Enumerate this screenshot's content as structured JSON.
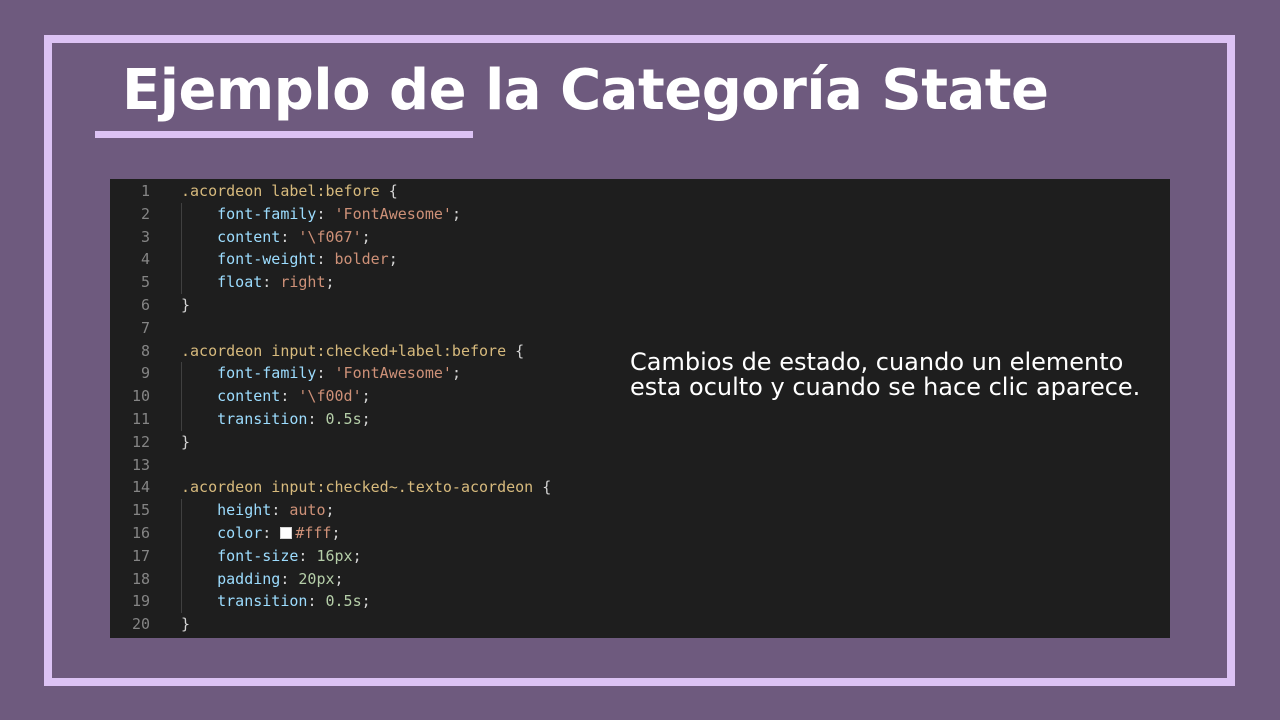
{
  "slide": {
    "title": "Ejemplo de la Categoría State",
    "note": "Cambios de estado, cuando un elemento esta oculto y cuando se hace clic aparece."
  },
  "code": {
    "lines": [
      {
        "n": "1",
        "tokens": [
          {
            "t": ".acordeon label:before",
            "c": "sel"
          },
          {
            "t": " {",
            "c": "punc"
          }
        ]
      },
      {
        "n": "2",
        "tokens": [
          {
            "t": "    ",
            "c": "punc"
          },
          {
            "t": "font-family",
            "c": "prop"
          },
          {
            "t": ": ",
            "c": "punc"
          },
          {
            "t": "'FontAwesome'",
            "c": "str"
          },
          {
            "t": ";",
            "c": "punc"
          }
        ]
      },
      {
        "n": "3",
        "tokens": [
          {
            "t": "    ",
            "c": "punc"
          },
          {
            "t": "content",
            "c": "prop"
          },
          {
            "t": ": ",
            "c": "punc"
          },
          {
            "t": "'\\f067'",
            "c": "str"
          },
          {
            "t": ";",
            "c": "punc"
          }
        ]
      },
      {
        "n": "4",
        "tokens": [
          {
            "t": "    ",
            "c": "punc"
          },
          {
            "t": "font-weight",
            "c": "prop"
          },
          {
            "t": ": ",
            "c": "punc"
          },
          {
            "t": "bolder",
            "c": "str"
          },
          {
            "t": ";",
            "c": "punc"
          }
        ]
      },
      {
        "n": "5",
        "tokens": [
          {
            "t": "    ",
            "c": "punc"
          },
          {
            "t": "float",
            "c": "prop"
          },
          {
            "t": ": ",
            "c": "punc"
          },
          {
            "t": "right",
            "c": "str"
          },
          {
            "t": ";",
            "c": "punc"
          }
        ]
      },
      {
        "n": "6",
        "tokens": [
          {
            "t": "}",
            "c": "punc"
          }
        ]
      },
      {
        "n": "7",
        "tokens": []
      },
      {
        "n": "8",
        "tokens": [
          {
            "t": ".acordeon input:checked+label:before",
            "c": "sel"
          },
          {
            "t": " {",
            "c": "punc"
          }
        ]
      },
      {
        "n": "9",
        "tokens": [
          {
            "t": "    ",
            "c": "punc"
          },
          {
            "t": "font-family",
            "c": "prop"
          },
          {
            "t": ": ",
            "c": "punc"
          },
          {
            "t": "'FontAwesome'",
            "c": "str"
          },
          {
            "t": ";",
            "c": "punc"
          }
        ]
      },
      {
        "n": "10",
        "tokens": [
          {
            "t": "    ",
            "c": "punc"
          },
          {
            "t": "content",
            "c": "prop"
          },
          {
            "t": ": ",
            "c": "punc"
          },
          {
            "t": "'\\f00d'",
            "c": "str"
          },
          {
            "t": ";",
            "c": "punc"
          }
        ]
      },
      {
        "n": "11",
        "tokens": [
          {
            "t": "    ",
            "c": "punc"
          },
          {
            "t": "transition",
            "c": "prop"
          },
          {
            "t": ": ",
            "c": "punc"
          },
          {
            "t": "0.5s",
            "c": "num"
          },
          {
            "t": ";",
            "c": "punc"
          }
        ]
      },
      {
        "n": "12",
        "tokens": [
          {
            "t": "}",
            "c": "punc"
          }
        ]
      },
      {
        "n": "13",
        "tokens": []
      },
      {
        "n": "14",
        "tokens": [
          {
            "t": ".acordeon input:checked~.texto-acordeon",
            "c": "sel"
          },
          {
            "t": " {",
            "c": "punc"
          }
        ]
      },
      {
        "n": "15",
        "tokens": [
          {
            "t": "    ",
            "c": "punc"
          },
          {
            "t": "height",
            "c": "prop"
          },
          {
            "t": ": ",
            "c": "punc"
          },
          {
            "t": "auto",
            "c": "str"
          },
          {
            "t": ";",
            "c": "punc"
          }
        ]
      },
      {
        "n": "16",
        "tokens": [
          {
            "t": "    ",
            "c": "punc"
          },
          {
            "t": "color",
            "c": "prop"
          },
          {
            "t": ": ",
            "c": "punc"
          },
          {
            "t": "",
            "c": "swatch"
          },
          {
            "t": "#fff",
            "c": "str"
          },
          {
            "t": ";",
            "c": "punc"
          }
        ]
      },
      {
        "n": "17",
        "tokens": [
          {
            "t": "    ",
            "c": "punc"
          },
          {
            "t": "font-size",
            "c": "prop"
          },
          {
            "t": ": ",
            "c": "punc"
          },
          {
            "t": "16px",
            "c": "num"
          },
          {
            "t": ";",
            "c": "punc"
          }
        ]
      },
      {
        "n": "18",
        "tokens": [
          {
            "t": "    ",
            "c": "punc"
          },
          {
            "t": "padding",
            "c": "prop"
          },
          {
            "t": ": ",
            "c": "punc"
          },
          {
            "t": "20px",
            "c": "num"
          },
          {
            "t": ";",
            "c": "punc"
          }
        ]
      },
      {
        "n": "19",
        "tokens": [
          {
            "t": "    ",
            "c": "punc"
          },
          {
            "t": "transition",
            "c": "prop"
          },
          {
            "t": ": ",
            "c": "punc"
          },
          {
            "t": "0.5s",
            "c": "num"
          },
          {
            "t": ";",
            "c": "punc"
          }
        ]
      },
      {
        "n": "20",
        "tokens": [
          {
            "t": "}",
            "c": "punc"
          }
        ]
      }
    ]
  },
  "colors": {
    "background": "#6e5a7e",
    "frame": "#dcc2f4",
    "code_background": "#1e1e1e"
  }
}
